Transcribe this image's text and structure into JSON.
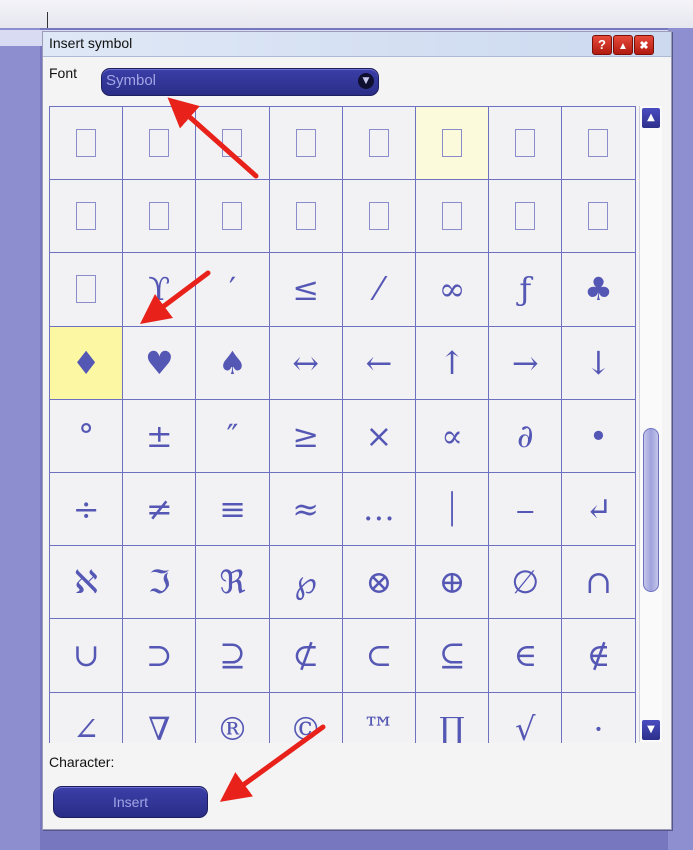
{
  "dialog": {
    "title": "Insert symbol",
    "help_label": "?",
    "minimize_label": "▲",
    "close_label": "✖",
    "font_label": "Font",
    "font_value": "Symbol",
    "character_label": "Character:",
    "insert_label": "Insert"
  },
  "grid": {
    "columns": 8,
    "rows": [
      [
        "",
        "",
        "",
        "",
        "",
        "",
        "",
        ""
      ],
      [
        "",
        "",
        "",
        "",
        "",
        "",
        "",
        ""
      ],
      [
        "",
        "ϒ",
        "′",
        "≤",
        "⁄",
        "∞",
        "ƒ",
        "♣"
      ],
      [
        "♦",
        "♥",
        "♠",
        "↔",
        "←",
        "↑",
        "→",
        "↓"
      ],
      [
        "°",
        "±",
        "″",
        "≥",
        "×",
        "∝",
        "∂",
        "•"
      ],
      [
        "÷",
        "≠",
        "≡",
        "≈",
        "…",
        "⏐",
        "⎯",
        "↵"
      ],
      [
        "ℵ",
        "ℑ",
        "ℜ",
        "℘",
        "⊗",
        "⊕",
        "∅",
        "∩"
      ],
      [
        "∪",
        "⊃",
        "⊇",
        "⊄",
        "⊂",
        "⊆",
        "∈",
        "∉"
      ],
      [
        "∠",
        "∇",
        "®",
        "©",
        "™",
        "∏",
        "√",
        "⋅"
      ]
    ],
    "placeholder_cells": [
      [
        0,
        0
      ],
      [
        0,
        1
      ],
      [
        0,
        2
      ],
      [
        0,
        3
      ],
      [
        0,
        4
      ],
      [
        0,
        5
      ],
      [
        0,
        6
      ],
      [
        0,
        7
      ],
      [
        1,
        0
      ],
      [
        1,
        1
      ],
      [
        1,
        2
      ],
      [
        1,
        3
      ],
      [
        1,
        4
      ],
      [
        1,
        5
      ],
      [
        1,
        6
      ],
      [
        1,
        7
      ],
      [
        2,
        0
      ]
    ],
    "hover_cell": [
      0,
      5
    ],
    "selected_cell": [
      3,
      0
    ]
  },
  "colors": {
    "accent": "#2a2d86",
    "grid_line": "#6e70c0",
    "symbol": "#5557b5",
    "selected_bg": "#fbf7a2",
    "arrow": "#e8221a"
  },
  "icons": {
    "help": "question-mark-icon",
    "minimize": "minimize-icon",
    "close": "close-icon",
    "dropdown": "chevron-down-icon",
    "scroll_up": "scroll-up-icon",
    "scroll_down": "scroll-down-icon"
  }
}
